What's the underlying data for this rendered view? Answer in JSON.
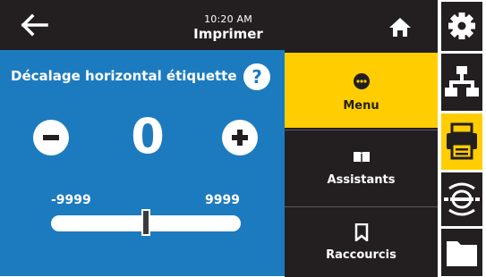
{
  "header": {
    "time": "10:20 AM",
    "title": "Imprimer",
    "back_icon": "arrow-left-icon",
    "home_icon": "home-icon"
  },
  "parameter": {
    "title": "Décalage horizontal étiquette",
    "help_label": "?",
    "value": "0",
    "numeric_value": 0,
    "min_label": "-9999",
    "max_label": "9999",
    "min": -9999,
    "max": 9999
  },
  "menu": {
    "items": [
      {
        "label": "Menu",
        "icon": "dots-menu-icon",
        "active": true
      },
      {
        "label": "Assistants",
        "icon": "book-icon",
        "active": false
      },
      {
        "label": "Raccourcis",
        "icon": "bookmark-icon",
        "active": false
      }
    ]
  },
  "sidebar": {
    "items": [
      {
        "icon": "gear-icon"
      },
      {
        "icon": "network-icon"
      },
      {
        "icon": "printer-icon",
        "active": true
      },
      {
        "icon": "rfid-icon"
      },
      {
        "icon": "folder-icon"
      }
    ]
  },
  "colors": {
    "accent": "#ffcd00",
    "content_bg": "#1c7bbf",
    "chrome": "#231f20"
  }
}
